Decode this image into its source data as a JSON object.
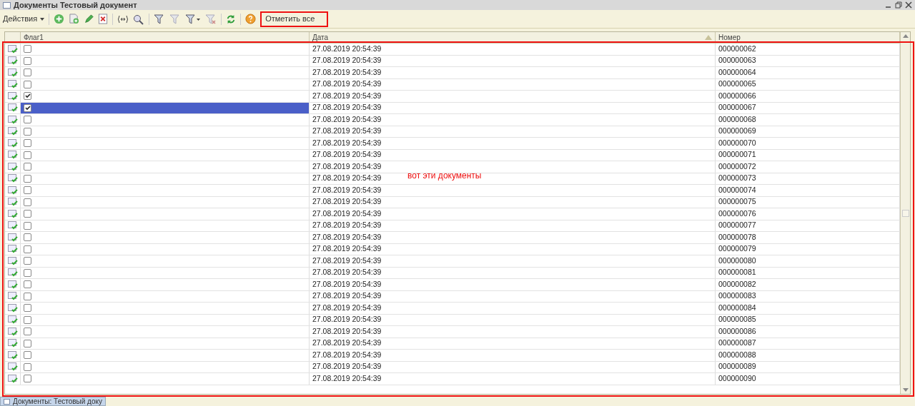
{
  "window": {
    "title": "Документы Тестовый документ"
  },
  "toolbar": {
    "actions_menu": "Действия",
    "mark_all_button": "Отметить все"
  },
  "table": {
    "columns": [
      "Флаг1",
      "Дата",
      "Номер"
    ],
    "rows": [
      {
        "flag": false,
        "date": "27.08.2019 20:54:39",
        "number": "000000062",
        "selected": false
      },
      {
        "flag": false,
        "date": "27.08.2019 20:54:39",
        "number": "000000063",
        "selected": false
      },
      {
        "flag": false,
        "date": "27.08.2019 20:54:39",
        "number": "000000064",
        "selected": false
      },
      {
        "flag": false,
        "date": "27.08.2019 20:54:39",
        "number": "000000065",
        "selected": false
      },
      {
        "flag": true,
        "date": "27.08.2019 20:54:39",
        "number": "000000066",
        "selected": false
      },
      {
        "flag": true,
        "date": "27.08.2019 20:54:39",
        "number": "000000067",
        "selected": true
      },
      {
        "flag": false,
        "date": "27.08.2019 20:54:39",
        "number": "000000068",
        "selected": false
      },
      {
        "flag": false,
        "date": "27.08.2019 20:54:39",
        "number": "000000069",
        "selected": false
      },
      {
        "flag": false,
        "date": "27.08.2019 20:54:39",
        "number": "000000070",
        "selected": false
      },
      {
        "flag": false,
        "date": "27.08.2019 20:54:39",
        "number": "000000071",
        "selected": false
      },
      {
        "flag": false,
        "date": "27.08.2019 20:54:39",
        "number": "000000072",
        "selected": false
      },
      {
        "flag": false,
        "date": "27.08.2019 20:54:39",
        "number": "000000073",
        "selected": false
      },
      {
        "flag": false,
        "date": "27.08.2019 20:54:39",
        "number": "000000074",
        "selected": false
      },
      {
        "flag": false,
        "date": "27.08.2019 20:54:39",
        "number": "000000075",
        "selected": false
      },
      {
        "flag": false,
        "date": "27.08.2019 20:54:39",
        "number": "000000076",
        "selected": false
      },
      {
        "flag": false,
        "date": "27.08.2019 20:54:39",
        "number": "000000077",
        "selected": false
      },
      {
        "flag": false,
        "date": "27.08.2019 20:54:39",
        "number": "000000078",
        "selected": false
      },
      {
        "flag": false,
        "date": "27.08.2019 20:54:39",
        "number": "000000079",
        "selected": false
      },
      {
        "flag": false,
        "date": "27.08.2019 20:54:39",
        "number": "000000080",
        "selected": false
      },
      {
        "flag": false,
        "date": "27.08.2019 20:54:39",
        "number": "000000081",
        "selected": false
      },
      {
        "flag": false,
        "date": "27.08.2019 20:54:39",
        "number": "000000082",
        "selected": false
      },
      {
        "flag": false,
        "date": "27.08.2019 20:54:39",
        "number": "000000083",
        "selected": false
      },
      {
        "flag": false,
        "date": "27.08.2019 20:54:39",
        "number": "000000084",
        "selected": false
      },
      {
        "flag": false,
        "date": "27.08.2019 20:54:39",
        "number": "000000085",
        "selected": false
      },
      {
        "flag": false,
        "date": "27.08.2019 20:54:39",
        "number": "000000086",
        "selected": false
      },
      {
        "flag": false,
        "date": "27.08.2019 20:54:39",
        "number": "000000087",
        "selected": false
      },
      {
        "flag": false,
        "date": "27.08.2019 20:54:39",
        "number": "000000088",
        "selected": false
      },
      {
        "flag": false,
        "date": "27.08.2019 20:54:39",
        "number": "000000089",
        "selected": false
      },
      {
        "flag": false,
        "date": "27.08.2019 20:54:39",
        "number": "000000090",
        "selected": false
      }
    ]
  },
  "annotation": {
    "text": "вот эти документы"
  },
  "taskbar": [
    {
      "label": "Документы: Тестовый доку"
    }
  ]
}
